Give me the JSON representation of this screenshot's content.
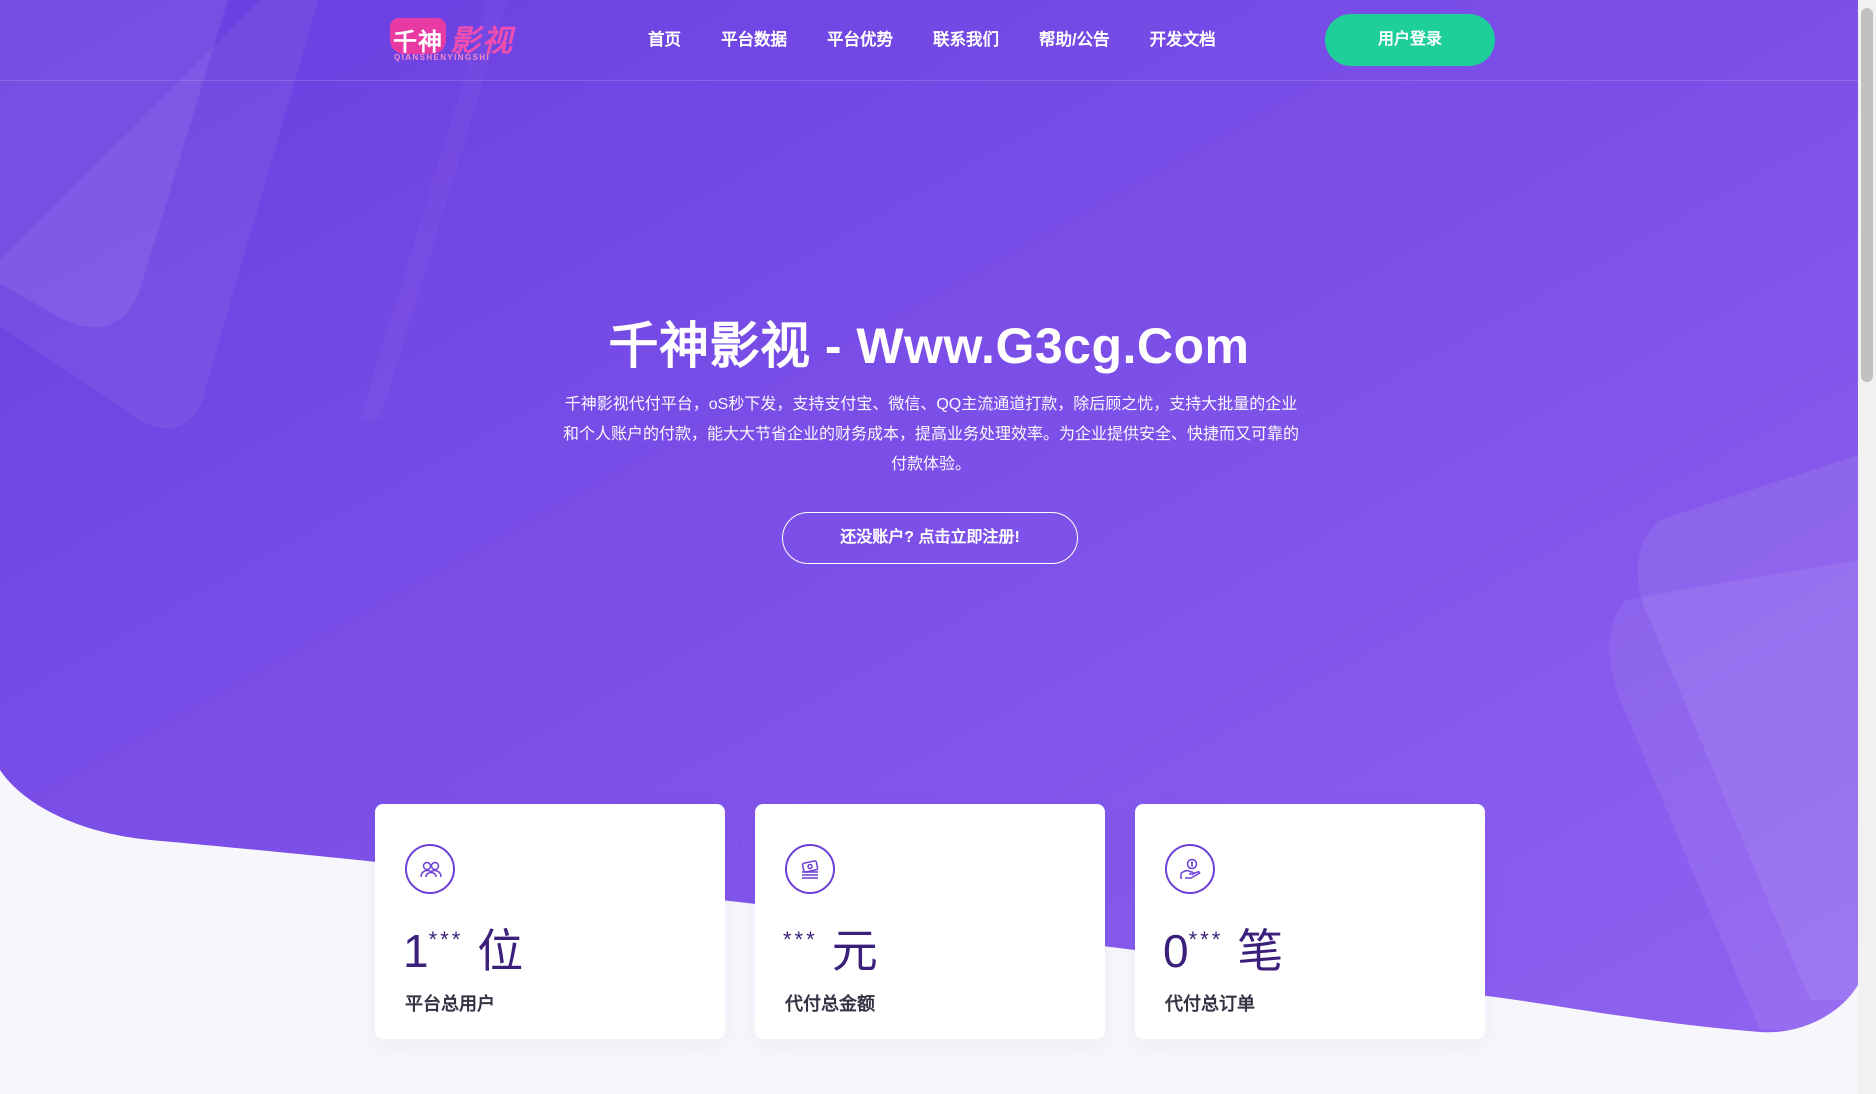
{
  "colors": {
    "hero_gradient_start": "#6a3ee0",
    "hero_gradient_end": "#8f63f0",
    "login_button": "#1ecf9a",
    "logo_pink": "#e93aa3",
    "stat_value": "#3b1f7a",
    "icon_purple": "#6c3fd6"
  },
  "header": {
    "logo": {
      "mark_text": "千神",
      "word_text": "影视",
      "sub_text": "QIANSHENYINGSHI"
    },
    "nav": [
      {
        "label": "首页"
      },
      {
        "label": "平台数据"
      },
      {
        "label": "平台优势"
      },
      {
        "label": "联系我们"
      },
      {
        "label": "帮助/公告"
      },
      {
        "label": "开发文档"
      }
    ],
    "login_label": "用户登录"
  },
  "hero": {
    "title": "千神影视 - Www.G3cg.Com",
    "description": "千神影视代付平台，oS秒下发，支持支付宝、微信、QQ主流通道打款，除后顾之忧，支持大批量的企业和个人账户的付款，能大大节省企业的财务成本，提高业务处理效率。为企业提供安全、快捷而又可靠的付款体验。",
    "signup_label": "还没账户? 点击立即注册!"
  },
  "stats": [
    {
      "icon": "users-icon",
      "value": "1",
      "stars": "***",
      "unit": "位",
      "label": "平台总用户"
    },
    {
      "icon": "money-stack-icon",
      "value": "",
      "stars": "***",
      "unit": "元",
      "label": "代付总金额"
    },
    {
      "icon": "hand-coin-icon",
      "value": "0",
      "stars": "***",
      "unit": "笔",
      "label": "代付总订单"
    }
  ]
}
